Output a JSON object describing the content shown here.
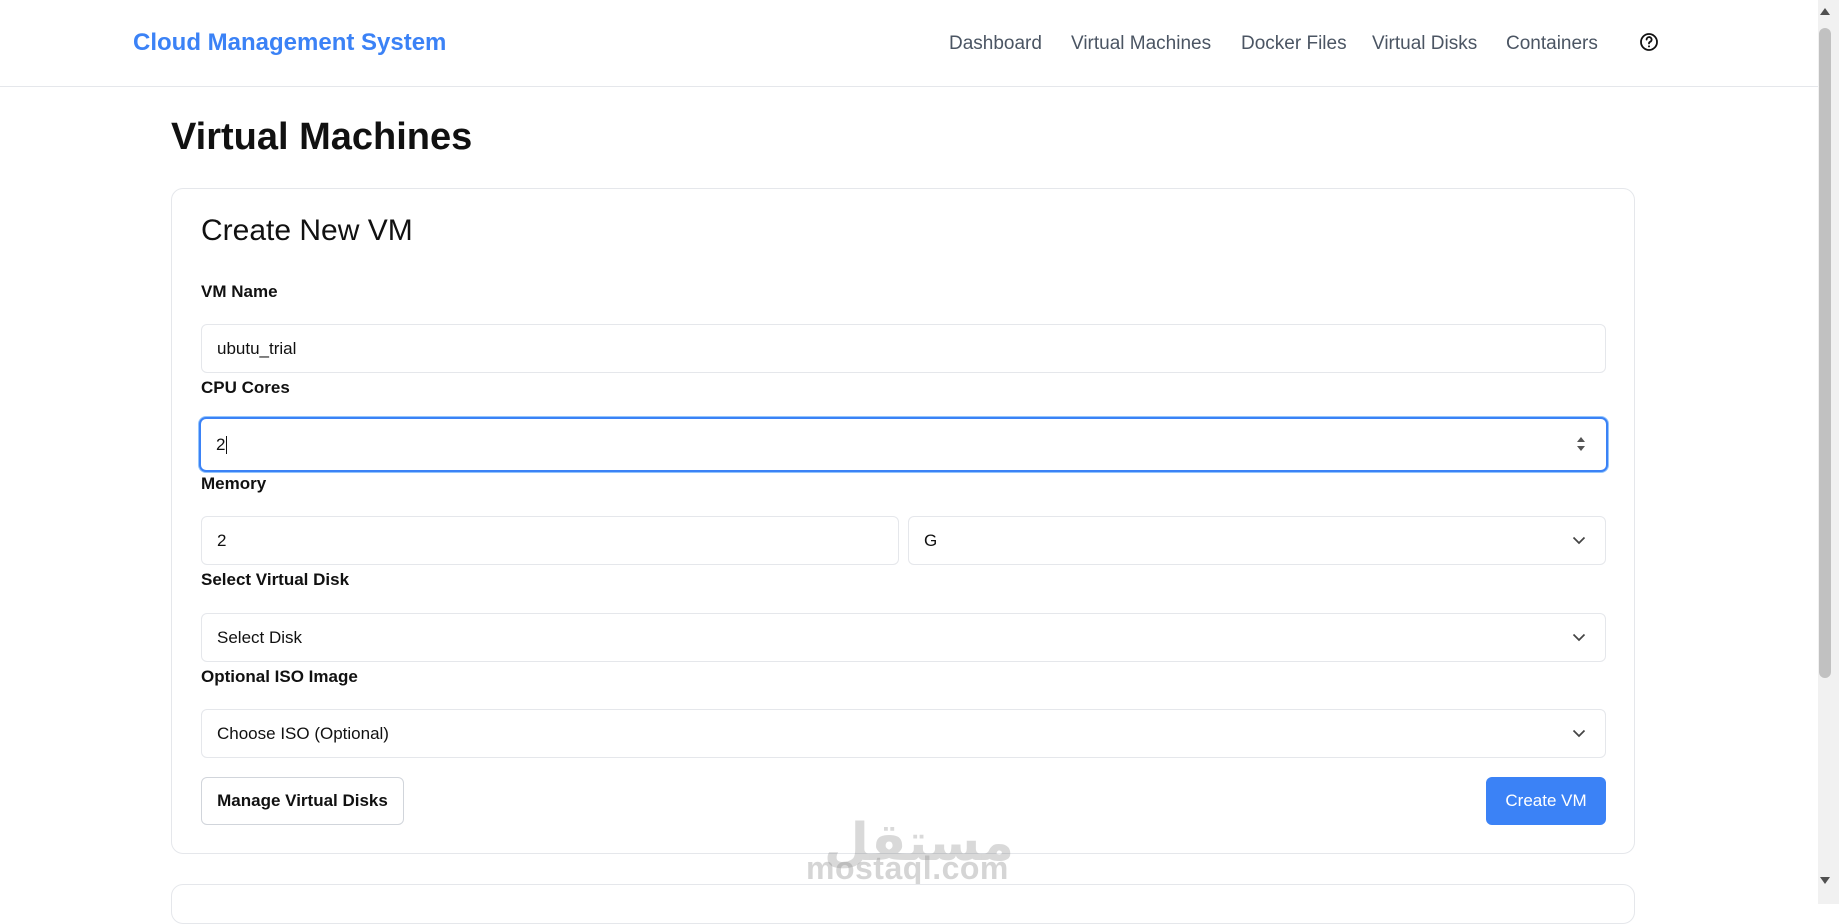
{
  "header": {
    "brand": "Cloud Management System",
    "nav": [
      "Dashboard",
      "Virtual Machines",
      "Docker Files",
      "Virtual Disks",
      "Containers"
    ],
    "help_icon": "help-circle-icon"
  },
  "page": {
    "title": "Virtual Machines"
  },
  "form": {
    "title": "Create New VM",
    "vm_name": {
      "label": "VM Name",
      "value": "ubutu_trial"
    },
    "cpu": {
      "label": "CPU Cores",
      "value": "2"
    },
    "memory": {
      "label": "Memory",
      "value": "2",
      "unit": "G"
    },
    "disk": {
      "label": "Select Virtual Disk",
      "value": "Select Disk"
    },
    "iso": {
      "label": "Optional ISO Image",
      "value": "Choose ISO (Optional)"
    },
    "manage_button": "Manage Virtual Disks",
    "create_button": "Create VM"
  },
  "watermark": {
    "latin": "mostaql.com",
    "arabic": "مستقل"
  },
  "colors": {
    "accent": "#3b82f6",
    "focus_ring": "#3b82f6"
  }
}
